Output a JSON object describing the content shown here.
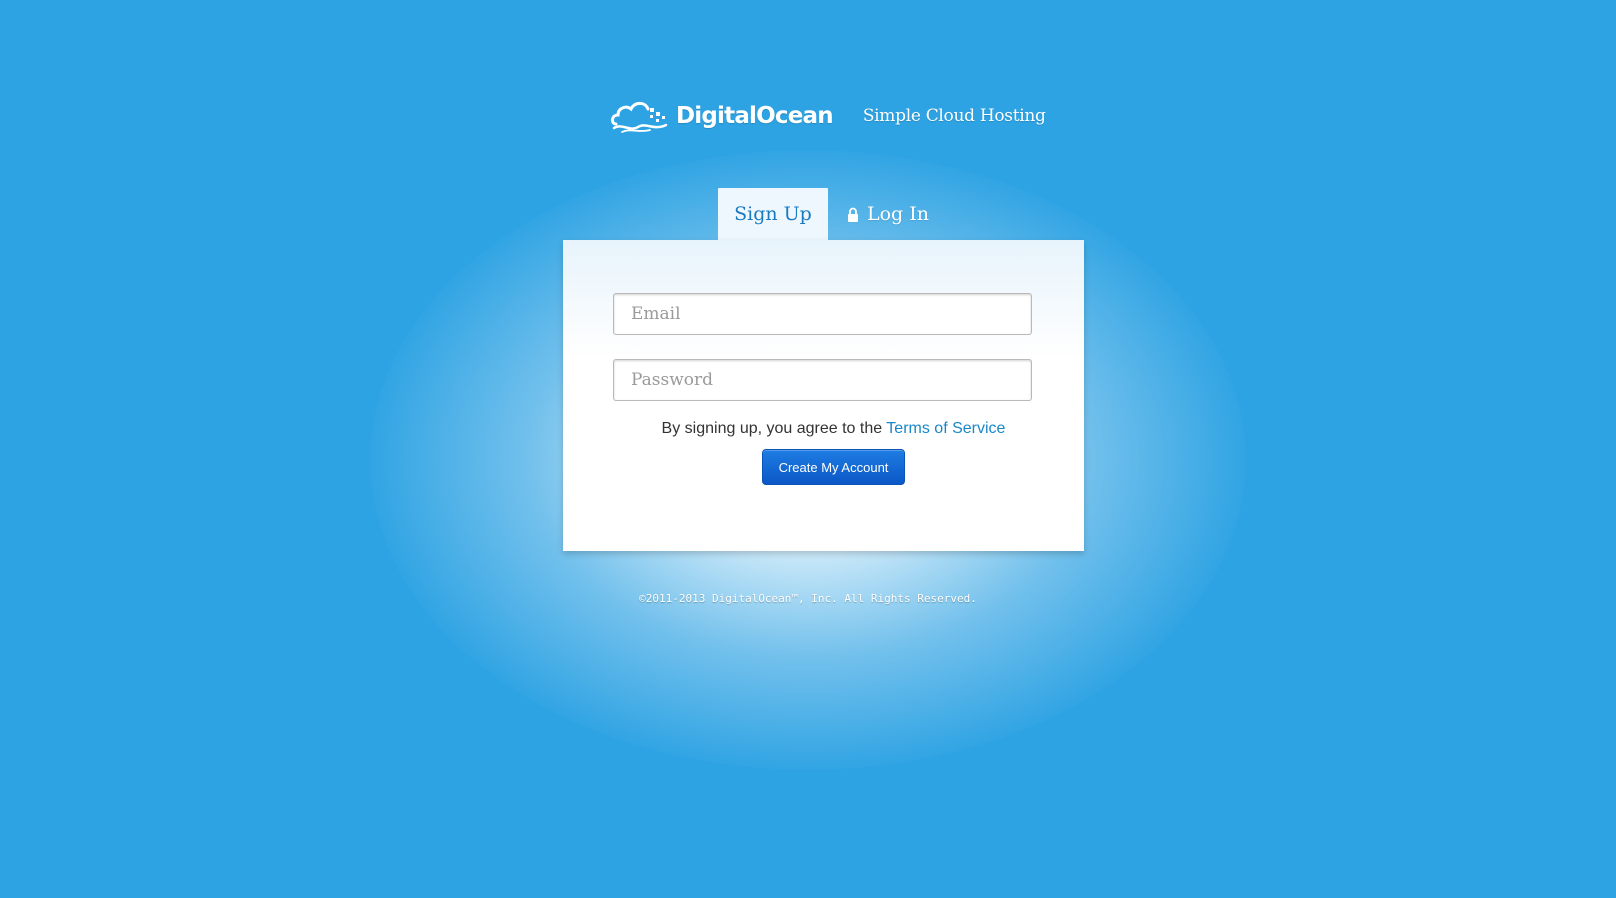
{
  "header": {
    "brand_name": "DigitalOcean",
    "tagline": "Simple Cloud Hosting",
    "logo_icon": "cloud-logo-icon"
  },
  "tabs": [
    {
      "label": "Sign Up",
      "active": true
    },
    {
      "label": "Log In",
      "active": false,
      "icon": "lock-icon"
    }
  ],
  "form": {
    "email_placeholder": "Email",
    "email_value": "",
    "password_placeholder": "Password",
    "password_value": "",
    "terms_prefix": "By signing up, you agree to the",
    "terms_link": "Terms of Service",
    "submit_label": "Create My Account"
  },
  "footer": {
    "copyright": "©2011-2013 DigitalOcean™, Inc. All Rights Reserved."
  },
  "colors": {
    "background": "#2ea3e3",
    "link": "#1a87c8",
    "button": "#0b57c6",
    "active_tab_text": "#1a7ac0"
  }
}
